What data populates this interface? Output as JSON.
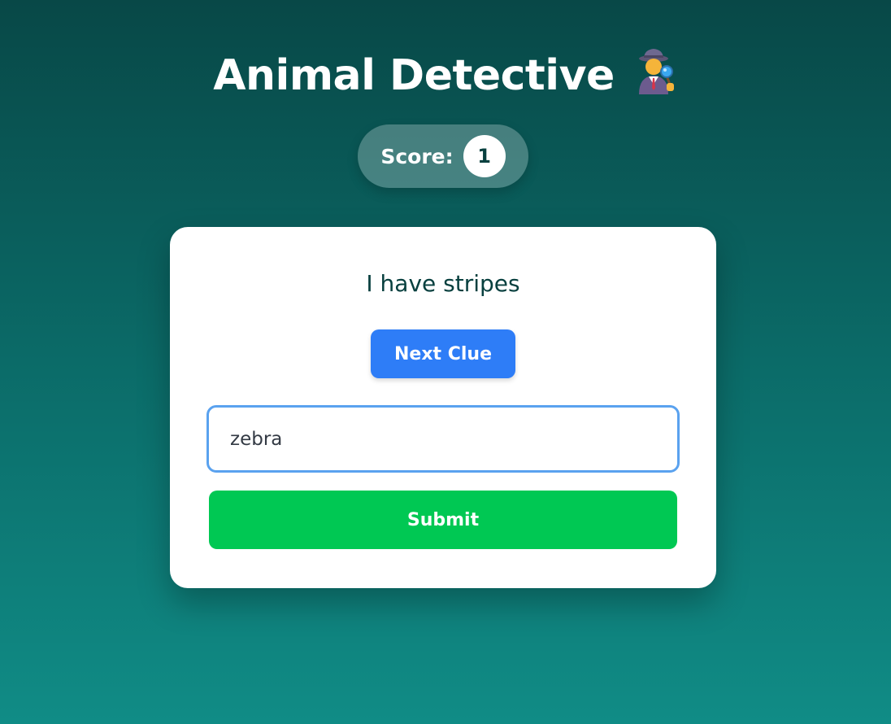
{
  "header": {
    "title": "Animal Detective",
    "icon": "detective-icon"
  },
  "score": {
    "label": "Score:",
    "value": "1"
  },
  "card": {
    "clue": "I have stripes",
    "next_clue_label": "Next Clue",
    "guess_value": "zebra",
    "submit_label": "Submit"
  },
  "colors": {
    "background_top": "#084847",
    "background_bottom": "#108c86",
    "next_button": "#2e7df7",
    "submit_button": "#00c853",
    "input_border": "#5aa2ef",
    "clue_text": "#08403f"
  }
}
